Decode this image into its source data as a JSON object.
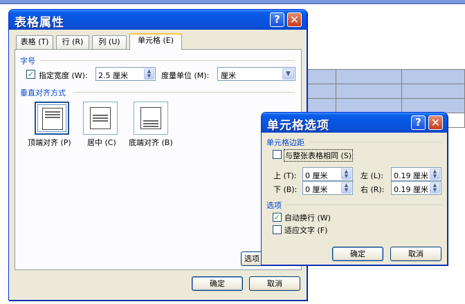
{
  "main_dialog": {
    "title": "表格属性",
    "help": "?",
    "close": "✕",
    "tabs": [
      "表格 (T)",
      "行 (R)",
      "列 (U)",
      "单元格 (E)"
    ],
    "size_group": "字号",
    "specify_width_label": "指定宽度 (W):",
    "width_value": "2.5 厘米",
    "unit_label": "度量单位 (M):",
    "unit_value": "厘米",
    "valign_group": "垂直对齐方式",
    "align_top": "顶端对齐 (P)",
    "align_center": "居中 (C)",
    "align_bottom": "底端对齐 (B)",
    "options_button": "选项",
    "ok": "确定",
    "cancel": "取消"
  },
  "cell_options": {
    "title": "单元格选项",
    "help": "?",
    "close": "✕",
    "margins_group": "单元格边距",
    "same_as_table": "与整张表格相同 (S)",
    "top_label": "上 (T):",
    "top_value": "0 厘米",
    "left_label": "左 (L):",
    "left_value": "0.19 厘米",
    "bottom_label": "下 (B):",
    "bottom_value": "0 厘米",
    "right_label": "右 (R):",
    "right_value": "0.19 厘米",
    "options_group": "选项",
    "wrap_text": "自动换行 (W)",
    "fit_text": "适应文字 (F)",
    "ok": "确定",
    "cancel": "取消"
  },
  "colors": {
    "titlebar": "#0854e0",
    "group_header": "#0046d5",
    "table_selection": "#b7c8e8"
  }
}
